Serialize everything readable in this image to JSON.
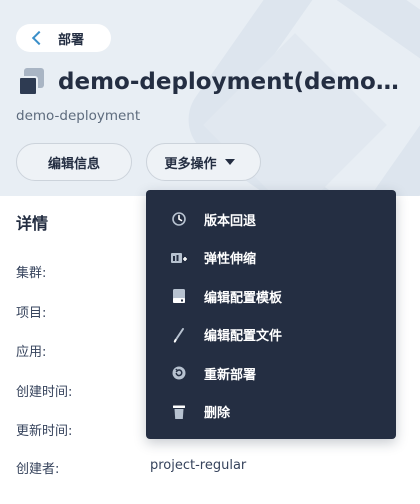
{
  "back": {
    "label": "部署"
  },
  "title": "demo-deployment(demo-deployment)",
  "subtitle": "demo-deployment",
  "buttons": {
    "edit_info": "编辑信息",
    "more_actions": "更多操作"
  },
  "details": {
    "heading": "详情",
    "rows": [
      {
        "label": "集群:",
        "value": ""
      },
      {
        "label": "项目:",
        "value": ""
      },
      {
        "label": "应用:",
        "value": ""
      },
      {
        "label": "创建时间:",
        "value": ""
      },
      {
        "label": "更新时间:",
        "value": ""
      },
      {
        "label": "创建者:",
        "value": "project-regular"
      }
    ]
  },
  "menu": {
    "items": [
      {
        "label": "版本回退",
        "icon": "history-icon"
      },
      {
        "label": "弹性伸缩",
        "icon": "autoscale-icon"
      },
      {
        "label": "编辑配置模板",
        "icon": "template-icon"
      },
      {
        "label": "编辑配置文件",
        "icon": "pen-icon"
      },
      {
        "label": "重新部署",
        "icon": "redeploy-icon"
      },
      {
        "label": "删除",
        "icon": "trash-icon"
      }
    ]
  }
}
